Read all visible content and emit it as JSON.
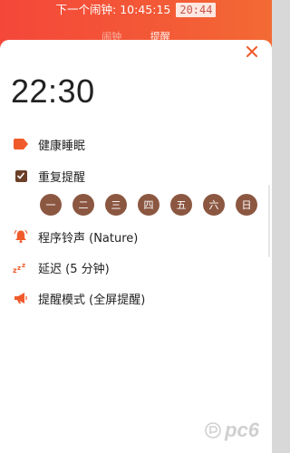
{
  "header": {
    "next_alarm_label": "下一个闹钟: 10:45:15",
    "clock_readout": "20:44",
    "tabs": [
      {
        "label": "闹钟",
        "active": false
      },
      {
        "label": "提醒",
        "active": true
      }
    ]
  },
  "sheet": {
    "time": "22:30",
    "tag": {
      "label": "健康睡眠",
      "icon": "tag-icon"
    },
    "repeat": {
      "label": "重复提醒",
      "checked": true,
      "icon": "checkbox-icon"
    },
    "days": [
      "一",
      "二",
      "三",
      "四",
      "五",
      "六",
      "日"
    ],
    "ringtone": {
      "label": "程序铃声 (Nature)",
      "icon": "bell-icon"
    },
    "snooze": {
      "label": "延迟 (5 分钟)",
      "icon": "snooze-icon"
    },
    "mode": {
      "label": "提醒模式 (全屏提醒)",
      "icon": "megaphone-icon"
    }
  },
  "watermark": {
    "text": "pc6"
  },
  "colors": {
    "accent": "#f05a2a",
    "day_chip": "#8c5741",
    "checkbox": "#6b3f28",
    "header_start": "#f4473a",
    "header_end": "#f36a34"
  }
}
